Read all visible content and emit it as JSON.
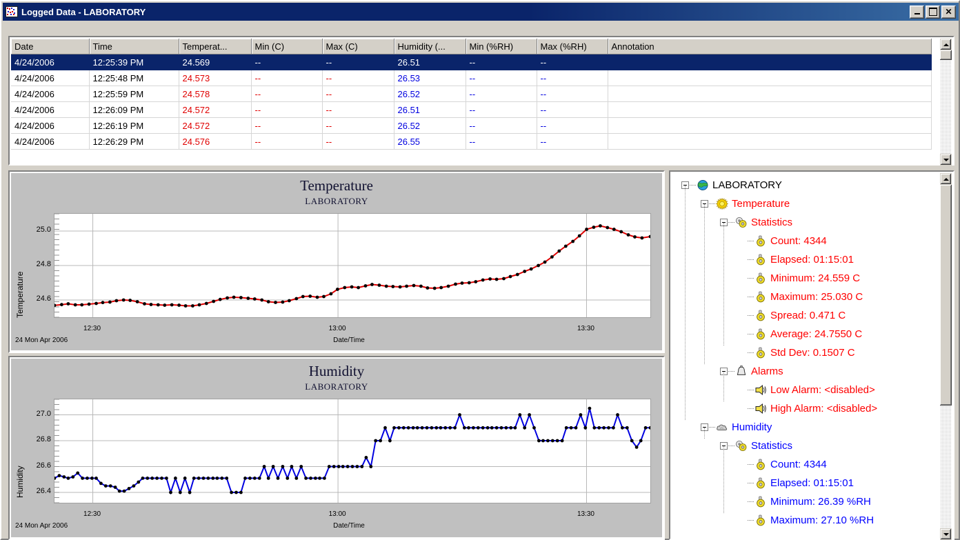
{
  "window": {
    "title": "Logged Data - LABORATORY",
    "icon": "logged-data-icon",
    "buttons": {
      "minimize": "_",
      "maximize": "□",
      "close": "✕"
    }
  },
  "grid": {
    "columns": [
      "Date",
      "Time",
      "Temperat...",
      "Min (C)",
      "Max (C)",
      "Humidity (...",
      "Min (%RH)",
      "Max (%RH)",
      "Annotation"
    ],
    "rows": [
      {
        "selected": true,
        "cells": [
          "4/24/2006",
          "12:25:39 PM",
          "24.569",
          "--",
          "--",
          "26.51",
          "--",
          "--",
          ""
        ]
      },
      {
        "selected": false,
        "cells": [
          "4/24/2006",
          "12:25:48 PM",
          "24.573",
          "--",
          "--",
          "26.53",
          "--",
          "--",
          ""
        ]
      },
      {
        "selected": false,
        "cells": [
          "4/24/2006",
          "12:25:59 PM",
          "24.578",
          "--",
          "--",
          "26.52",
          "--",
          "--",
          ""
        ]
      },
      {
        "selected": false,
        "cells": [
          "4/24/2006",
          "12:26:09 PM",
          "24.572",
          "--",
          "--",
          "26.51",
          "--",
          "--",
          ""
        ]
      },
      {
        "selected": false,
        "cells": [
          "4/24/2006",
          "12:26:19 PM",
          "24.572",
          "--",
          "--",
          "26.52",
          "--",
          "--",
          ""
        ]
      },
      {
        "selected": false,
        "cells": [
          "4/24/2006",
          "12:26:29 PM",
          "24.576",
          "--",
          "--",
          "26.55",
          "--",
          "--",
          ""
        ]
      }
    ]
  },
  "colors": {
    "temperature": "#e00000",
    "humidity": "#0000e0",
    "selection": "#0a246a",
    "titlebar": "#0a246a",
    "face": "#d4d0c8",
    "chart_bg": "#c0c0c0"
  },
  "chart_data": [
    {
      "type": "line",
      "name": "temperature-chart",
      "title": "Temperature",
      "subtitle": "LABORATORY",
      "xlabel": "Date/Time",
      "ylabel": "Temperature",
      "datestamp": "24 Mon Apr 2006",
      "ylim": [
        24.5,
        25.1
      ],
      "yticks": [
        24.6,
        24.8,
        25.0
      ],
      "yticklabels": [
        "24.6",
        "24.8",
        "25.0"
      ],
      "xticks": [
        "12:30",
        "13:00",
        "13:30"
      ],
      "xtick_positions": [
        0.0643,
        0.4758,
        0.8929
      ],
      "grid": true,
      "marker": "circle",
      "color": "#e00000",
      "x": [
        0.0,
        0.012,
        0.023,
        0.035,
        0.046,
        0.058,
        0.07,
        0.081,
        0.093,
        0.104,
        0.116,
        0.127,
        0.139,
        0.151,
        0.162,
        0.174,
        0.185,
        0.197,
        0.209,
        0.22,
        0.232,
        0.243,
        0.255,
        0.267,
        0.278,
        0.29,
        0.301,
        0.313,
        0.325,
        0.336,
        0.348,
        0.359,
        0.371,
        0.383,
        0.394,
        0.406,
        0.417,
        0.429,
        0.441,
        0.452,
        0.464,
        0.475,
        0.487,
        0.499,
        0.51,
        0.522,
        0.533,
        0.545,
        0.557,
        0.568,
        0.58,
        0.591,
        0.603,
        0.615,
        0.626,
        0.638,
        0.649,
        0.661,
        0.673,
        0.684,
        0.696,
        0.707,
        0.719,
        0.731,
        0.742,
        0.754,
        0.765,
        0.777,
        0.789,
        0.8,
        0.812,
        0.823,
        0.835,
        0.847,
        0.858,
        0.87,
        0.881,
        0.893,
        0.905,
        0.916,
        0.928,
        0.939,
        0.951,
        0.963,
        0.974,
        0.986,
        1.0
      ],
      "values": [
        24.569,
        24.573,
        24.578,
        24.572,
        24.572,
        24.576,
        24.58,
        24.585,
        24.588,
        24.596,
        24.6,
        24.598,
        24.59,
        24.578,
        24.574,
        24.572,
        24.57,
        24.572,
        24.57,
        24.566,
        24.566,
        24.572,
        24.58,
        24.592,
        24.603,
        24.612,
        24.616,
        24.614,
        24.61,
        24.606,
        24.6,
        24.59,
        24.586,
        24.588,
        24.596,
        24.608,
        24.62,
        24.622,
        24.616,
        24.62,
        24.636,
        24.662,
        24.672,
        24.676,
        24.672,
        24.682,
        24.69,
        24.686,
        24.68,
        24.678,
        24.676,
        24.68,
        24.684,
        24.68,
        24.67,
        24.668,
        24.672,
        24.68,
        24.692,
        24.698,
        24.7,
        24.706,
        24.716,
        24.722,
        24.72,
        24.724,
        24.736,
        24.748,
        24.766,
        24.78,
        24.8,
        24.82,
        24.85,
        24.884,
        24.912,
        24.94,
        24.972,
        25.01,
        25.022,
        25.03,
        25.02,
        25.01,
        24.996,
        24.978,
        24.966,
        24.96,
        24.968
      ]
    },
    {
      "type": "line",
      "name": "humidity-chart",
      "title": "Humidity",
      "subtitle": "LABORATORY",
      "xlabel": "Date/Time",
      "ylabel": "Humidity",
      "datestamp": "24 Mon Apr 2006",
      "ylim": [
        26.32,
        27.12
      ],
      "yticks": [
        26.4,
        26.6,
        26.8,
        27.0
      ],
      "yticklabels": [
        "26.4",
        "26.6",
        "26.8",
        "27.0"
      ],
      "xticks": [
        "12:30",
        "13:00",
        "13:30"
      ],
      "xtick_positions": [
        0.0643,
        0.4758,
        0.8929
      ],
      "grid": true,
      "marker": "circle",
      "color": "#0000e0",
      "x": [
        0.0,
        0.008,
        0.016,
        0.023,
        0.031,
        0.039,
        0.047,
        0.055,
        0.063,
        0.07,
        0.078,
        0.086,
        0.094,
        0.102,
        0.109,
        0.117,
        0.125,
        0.133,
        0.141,
        0.148,
        0.156,
        0.164,
        0.172,
        0.18,
        0.188,
        0.195,
        0.203,
        0.211,
        0.219,
        0.227,
        0.234,
        0.242,
        0.25,
        0.258,
        0.266,
        0.273,
        0.281,
        0.289,
        0.297,
        0.305,
        0.313,
        0.32,
        0.328,
        0.336,
        0.344,
        0.352,
        0.359,
        0.367,
        0.375,
        0.383,
        0.391,
        0.398,
        0.406,
        0.414,
        0.422,
        0.43,
        0.438,
        0.445,
        0.453,
        0.461,
        0.469,
        0.477,
        0.484,
        0.492,
        0.5,
        0.508,
        0.516,
        0.523,
        0.531,
        0.539,
        0.547,
        0.555,
        0.563,
        0.57,
        0.578,
        0.586,
        0.594,
        0.602,
        0.609,
        0.617,
        0.625,
        0.633,
        0.641,
        0.648,
        0.656,
        0.664,
        0.672,
        0.68,
        0.688,
        0.695,
        0.703,
        0.711,
        0.719,
        0.727,
        0.734,
        0.742,
        0.75,
        0.758,
        0.766,
        0.773,
        0.781,
        0.789,
        0.797,
        0.805,
        0.813,
        0.82,
        0.828,
        0.836,
        0.844,
        0.852,
        0.859,
        0.867,
        0.875,
        0.883,
        0.891,
        0.898,
        0.906,
        0.914,
        0.922,
        0.93,
        0.938,
        0.945,
        0.953,
        0.961,
        0.969,
        0.977,
        0.984,
        0.992,
        1.0
      ],
      "values": [
        26.51,
        26.53,
        26.52,
        26.51,
        26.52,
        26.55,
        26.51,
        26.51,
        26.51,
        26.51,
        26.47,
        26.45,
        26.45,
        26.44,
        26.41,
        26.41,
        26.43,
        26.45,
        26.48,
        26.51,
        26.51,
        26.51,
        26.51,
        26.51,
        26.51,
        26.4,
        26.51,
        26.4,
        26.51,
        26.4,
        26.51,
        26.51,
        26.51,
        26.51,
        26.51,
        26.51,
        26.51,
        26.51,
        26.4,
        26.4,
        26.4,
        26.51,
        26.51,
        26.51,
        26.51,
        26.6,
        26.51,
        26.6,
        26.51,
        26.6,
        26.51,
        26.6,
        26.51,
        26.6,
        26.51,
        26.51,
        26.51,
        26.51,
        26.51,
        26.6,
        26.6,
        26.6,
        26.6,
        26.6,
        26.6,
        26.6,
        26.6,
        26.67,
        26.6,
        26.8,
        26.8,
        26.9,
        26.8,
        26.9,
        26.9,
        26.9,
        26.9,
        26.9,
        26.9,
        26.9,
        26.9,
        26.9,
        26.9,
        26.9,
        26.9,
        26.9,
        26.9,
        27.0,
        26.9,
        26.9,
        26.9,
        26.9,
        26.9,
        26.9,
        26.9,
        26.9,
        26.9,
        26.9,
        26.9,
        26.9,
        27.0,
        26.9,
        27.0,
        26.9,
        26.8,
        26.8,
        26.8,
        26.8,
        26.8,
        26.8,
        26.9,
        26.9,
        26.9,
        27.0,
        26.9,
        27.05,
        26.9,
        26.9,
        26.9,
        26.9,
        26.9,
        27.0,
        26.9,
        26.9,
        26.8,
        26.75,
        26.8,
        26.9,
        26.9
      ]
    }
  ],
  "tree": {
    "nodes": [
      {
        "depth": 0,
        "expander": "minus",
        "icon": "globe-icon",
        "label": "LABORATORY",
        "color": "blk"
      },
      {
        "depth": 1,
        "expander": "minus",
        "icon": "sun-icon",
        "label": "Temperature",
        "color": "red"
      },
      {
        "depth": 2,
        "expander": "minus",
        "icon": "gears-icon",
        "label": "Statistics",
        "color": "red"
      },
      {
        "depth": 3,
        "expander": "none",
        "icon": "gear-icon",
        "label": "Count: 4344",
        "color": "red"
      },
      {
        "depth": 3,
        "expander": "none",
        "icon": "gear-icon",
        "label": "Elapsed: 01:15:01",
        "color": "red"
      },
      {
        "depth": 3,
        "expander": "none",
        "icon": "gear-icon",
        "label": "Minimum: 24.559 C",
        "color": "red"
      },
      {
        "depth": 3,
        "expander": "none",
        "icon": "gear-icon",
        "label": "Maximum: 25.030 C",
        "color": "red"
      },
      {
        "depth": 3,
        "expander": "none",
        "icon": "gear-icon",
        "label": "Spread: 0.471 C",
        "color": "red"
      },
      {
        "depth": 3,
        "expander": "none",
        "icon": "gear-icon",
        "label": "Average: 24.7550 C",
        "color": "red"
      },
      {
        "depth": 3,
        "expander": "none",
        "icon": "gear-icon",
        "label": "Std Dev: 0.1507 C",
        "color": "red"
      },
      {
        "depth": 2,
        "expander": "minus",
        "icon": "bell-icon",
        "label": "Alarms",
        "color": "red"
      },
      {
        "depth": 3,
        "expander": "none",
        "icon": "horn-icon",
        "label": "Low Alarm: <disabled>",
        "color": "red"
      },
      {
        "depth": 3,
        "expander": "none",
        "icon": "horn-icon",
        "label": "High Alarm: <disabled>",
        "color": "red"
      },
      {
        "depth": 1,
        "expander": "minus",
        "icon": "cloud-icon",
        "label": "Humidity",
        "color": "blue"
      },
      {
        "depth": 2,
        "expander": "minus",
        "icon": "gears-icon",
        "label": "Statistics",
        "color": "blue"
      },
      {
        "depth": 3,
        "expander": "none",
        "icon": "gear-icon",
        "label": "Count: 4344",
        "color": "blue"
      },
      {
        "depth": 3,
        "expander": "none",
        "icon": "gear-icon",
        "label": "Elapsed: 01:15:01",
        "color": "blue"
      },
      {
        "depth": 3,
        "expander": "none",
        "icon": "gear-icon",
        "label": "Minimum: 26.39 %RH",
        "color": "blue"
      },
      {
        "depth": 3,
        "expander": "none",
        "icon": "gear-icon",
        "label": "Maximum: 27.10 %RH",
        "color": "blue"
      }
    ]
  }
}
